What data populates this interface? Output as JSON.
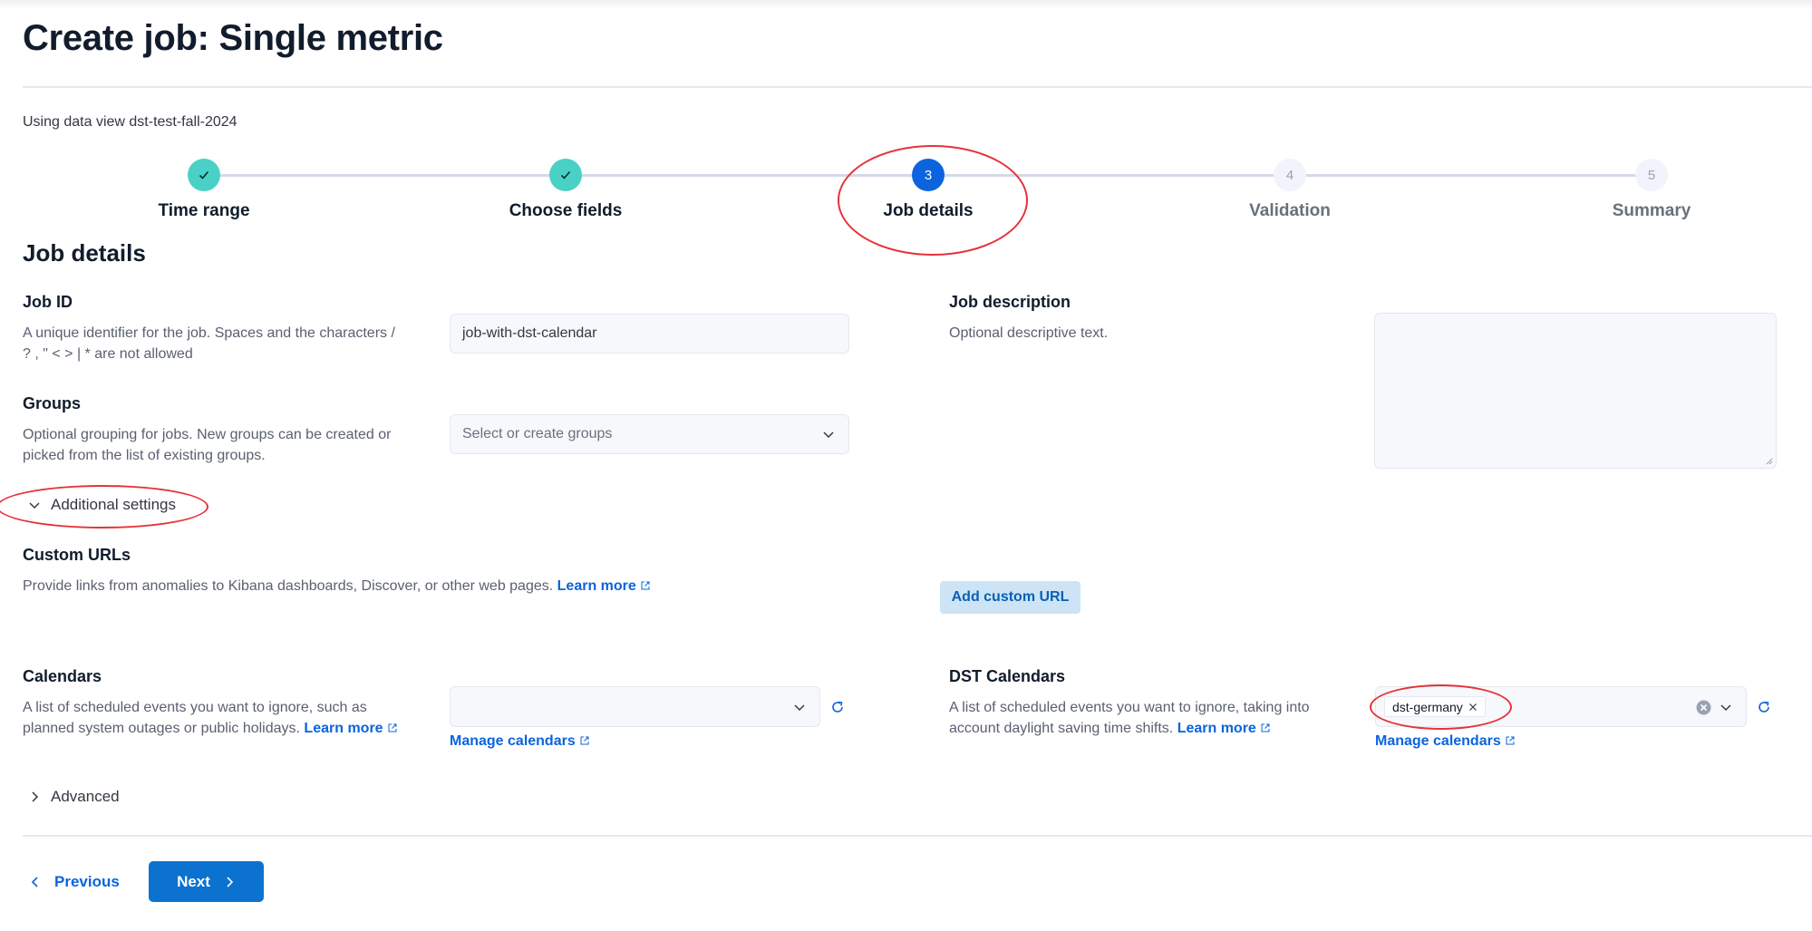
{
  "header": {
    "title": "Create job: Single metric",
    "data_view_text": "Using data view dst-test-fall-2024"
  },
  "stepper": {
    "steps": [
      {
        "number": "1",
        "label": "Time range",
        "status": "complete"
      },
      {
        "number": "2",
        "label": "Choose fields",
        "status": "complete"
      },
      {
        "number": "3",
        "label": "Job details",
        "status": "current"
      },
      {
        "number": "4",
        "label": "Validation",
        "status": "incomplete"
      },
      {
        "number": "5",
        "label": "Summary",
        "status": "incomplete"
      }
    ]
  },
  "job_details": {
    "section_title": "Job details",
    "job_id": {
      "label": "Job ID",
      "help_line1": "A unique identifier for the job. Spaces and the characters /",
      "help_line2": "? , \" < > | * are not allowed",
      "value": "job-with-dst-calendar"
    },
    "groups": {
      "label": "Groups",
      "help_line1": "Optional grouping for jobs. New groups can be created or",
      "help_line2": "picked from the list of existing groups.",
      "placeholder": "Select or create groups"
    },
    "job_description": {
      "label": "Job description",
      "help": "Optional descriptive text.",
      "value": ""
    }
  },
  "additional_settings": {
    "toggle_label": "Additional settings",
    "expanded": true,
    "custom_urls": {
      "label": "Custom URLs",
      "help": "Provide links from anomalies to Kibana dashboards, Discover, or other web pages.",
      "learn_more": "Learn more",
      "add_button": "Add custom URL"
    },
    "calendars": {
      "label": "Calendars",
      "help_line1": "A list of scheduled events you want to ignore, such as",
      "help_line2": "planned system outages or public holidays.",
      "learn_more": "Learn more",
      "selected": [],
      "manage_link": "Manage calendars"
    },
    "dst_calendars": {
      "label": "DST Calendars",
      "help_line1": "A list of scheduled events you want to ignore, taking into",
      "help_line2": "account daylight saving time shifts.",
      "learn_more": "Learn more",
      "selected": [
        "dst-germany"
      ],
      "manage_link": "Manage calendars"
    }
  },
  "advanced": {
    "toggle_label": "Advanced",
    "expanded": false
  },
  "footer": {
    "previous_label": "Previous",
    "next_label": "Next"
  },
  "colors": {
    "primary": "#0b64dd",
    "step_complete": "#4ad1c6",
    "annotation": "#e5323a"
  }
}
